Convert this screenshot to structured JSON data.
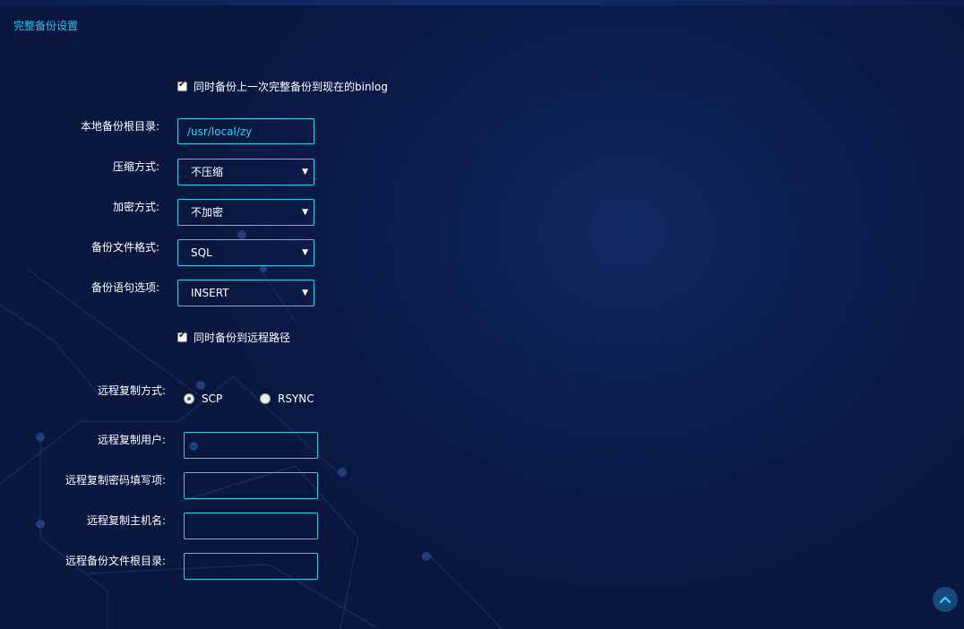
{
  "panel_title": "完整备份设置",
  "binlog_checkbox": {
    "label": "同时备份上一次完整备份到现在的binlog",
    "checked": true
  },
  "fields": {
    "local_root": {
      "label": "本地备份根目录:",
      "value": "/usr/local/zy"
    },
    "compression": {
      "label": "压缩方式:",
      "value": "不压缩"
    },
    "encryption": {
      "label": "加密方式:",
      "value": "不加密"
    },
    "file_format": {
      "label": "备份文件格式:",
      "value": "SQL"
    },
    "statement": {
      "label": "备份语句选项:",
      "value": "INSERT"
    }
  },
  "remote_checkbox": {
    "label": "同时备份到远程路径",
    "checked": true
  },
  "remote": {
    "copy_method": {
      "label": "远程复制方式:",
      "options": [
        "SCP",
        "RSYNC"
      ],
      "selected": "SCP"
    },
    "user": {
      "label": "远程复制用户:",
      "value": ""
    },
    "password": {
      "label": "远程复制密码填写项:",
      "value": ""
    },
    "host": {
      "label": "远程复制主机名:",
      "value": ""
    },
    "root_dir": {
      "label": "远程备份文件根目录:",
      "value": ""
    }
  },
  "colors": {
    "accent": "#2ad1ef",
    "background": "#0b1a47"
  },
  "icons": {
    "scroll_top": "chevron-up-icon",
    "select_arrow": "caret-down-icon"
  }
}
